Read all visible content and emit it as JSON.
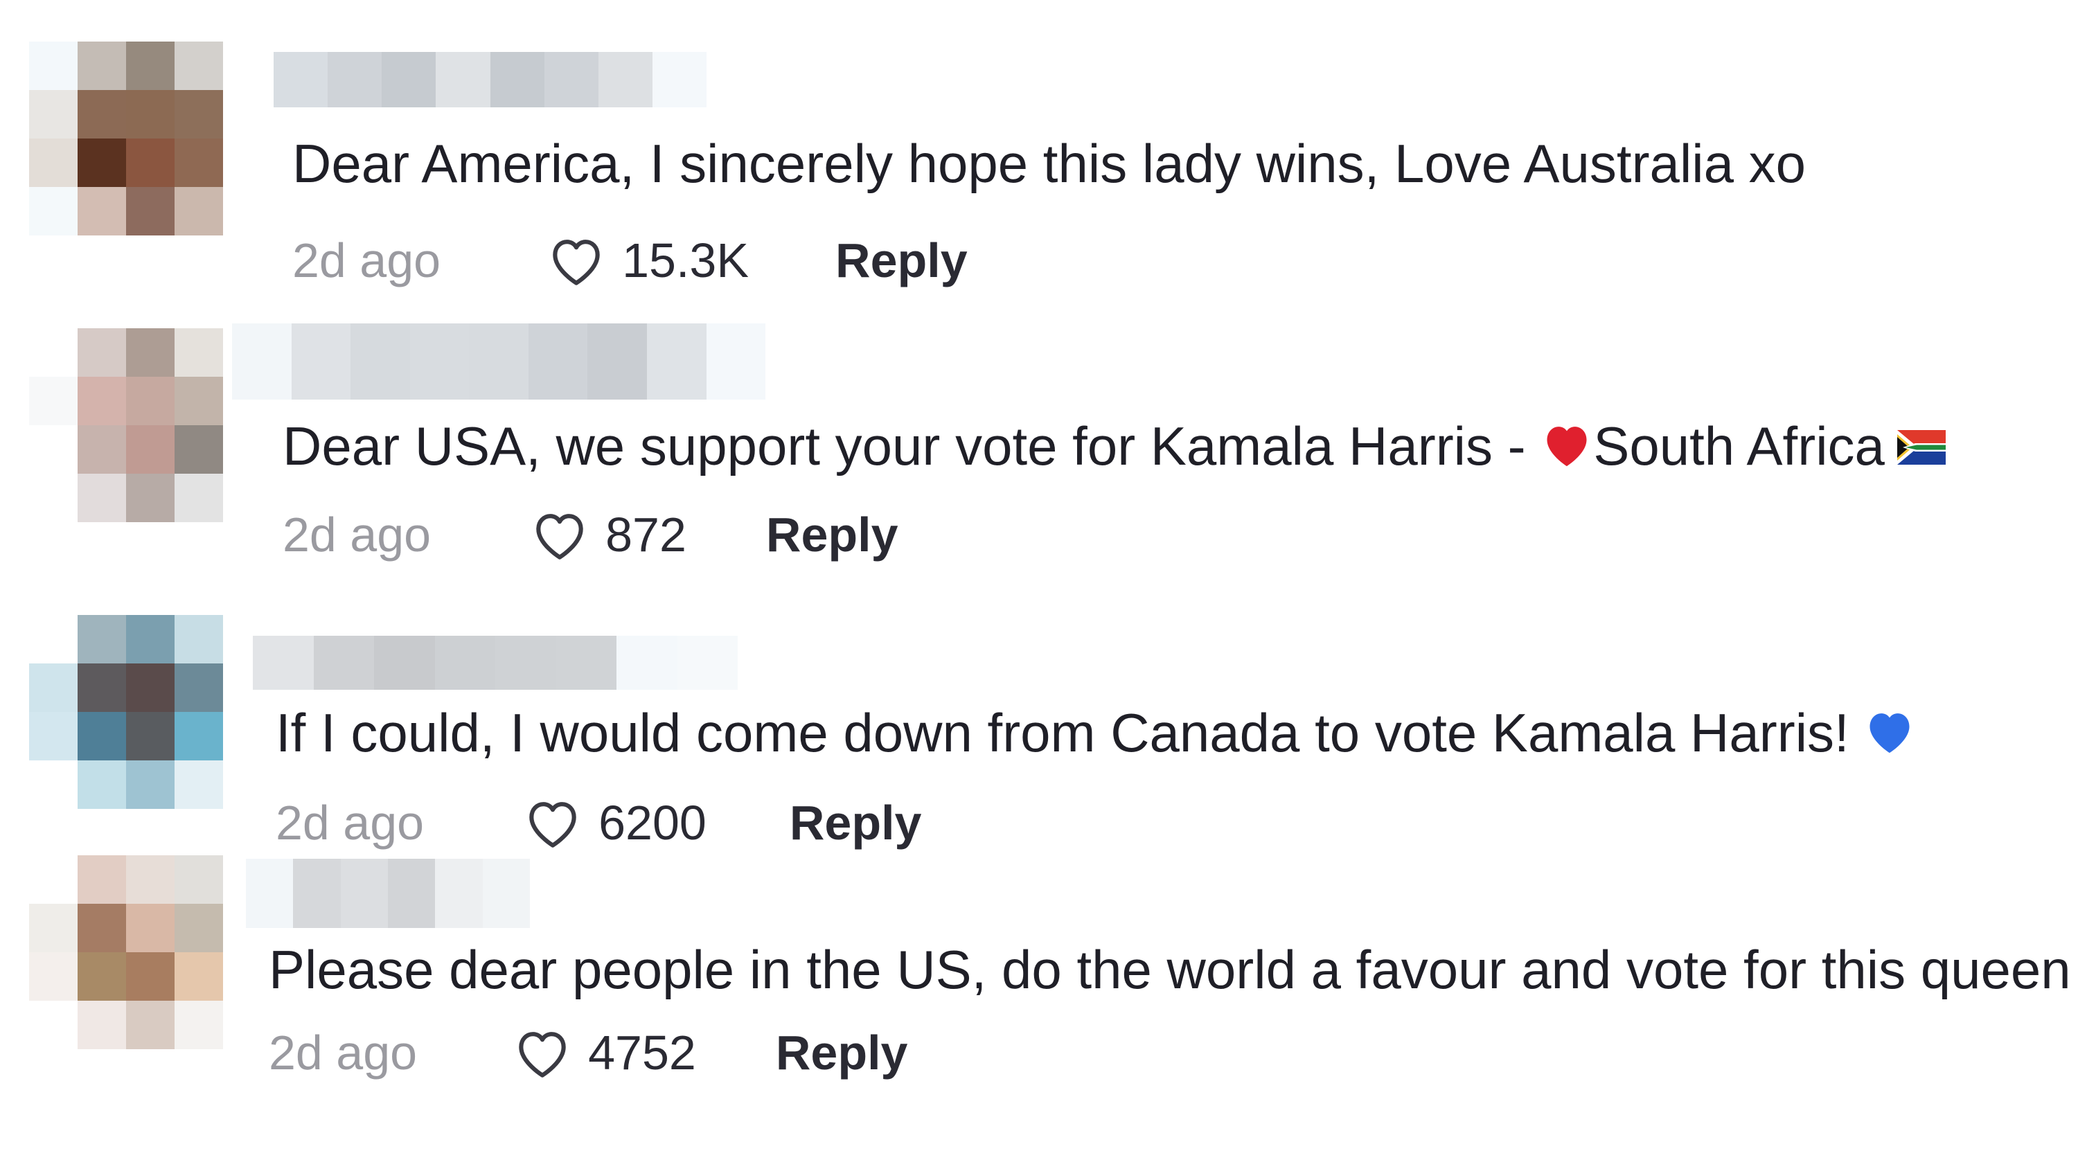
{
  "comments": [
    {
      "text": "Dear America, I sincerely hope this lady wins, Love Australia xo",
      "time": "2d ago",
      "likes": "15.3K",
      "reply_label": "Reply",
      "emoji": null
    },
    {
      "text_before": "Dear USA, we support your vote for Kamala Harris - ",
      "text_after": "South Africa",
      "time": "2d ago",
      "likes": "872",
      "reply_label": "Reply",
      "emoji": "red-heart-icon, south-africa-flag-icon"
    },
    {
      "text": "If I could, I would come down from Canada to vote Kamala Harris!",
      "time": "2d ago",
      "likes": "6200",
      "reply_label": "Reply",
      "emoji": "blue-heart-icon"
    },
    {
      "text": "Please dear people in the US, do the world a favour and vote for this queen",
      "time": "2d ago",
      "likes": "4752",
      "reply_label": "Reply",
      "emoji": null
    }
  ],
  "colors": {
    "text": "#1f1f27",
    "muted": "#9a9aa0",
    "red_heart": "#e0202e",
    "blue_heart": "#2f6fe8"
  }
}
